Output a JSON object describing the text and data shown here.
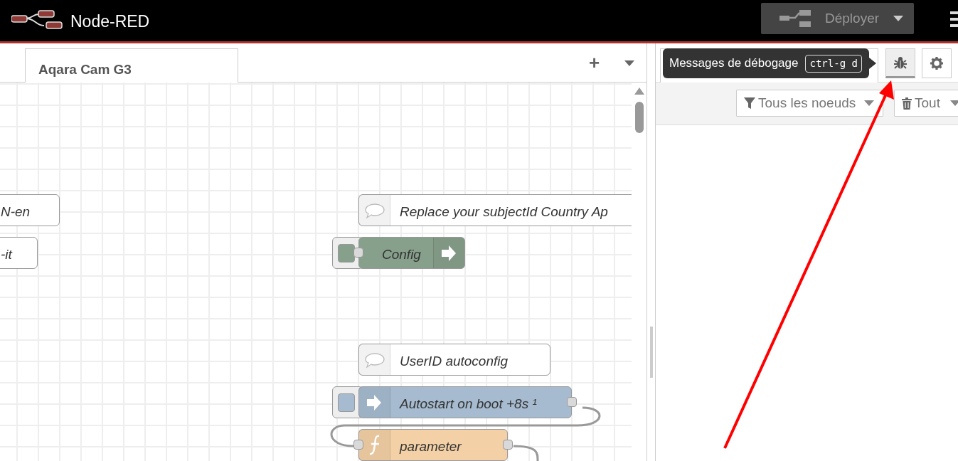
{
  "header": {
    "title": "Node-RED",
    "deploy": {
      "label": "Déployer",
      "disabled": true
    }
  },
  "workspace": {
    "tabs": [
      {
        "label": "Aqara Cam G3",
        "selected": true
      }
    ],
    "add_button": "+"
  },
  "nodes": [
    {
      "kind": "comment",
      "label": "N-en",
      "color": "#ffffff",
      "inputs": false,
      "outputs": false
    },
    {
      "kind": "comment",
      "label": "-it",
      "color": "#ffffff",
      "inputs": false,
      "outputs": false
    },
    {
      "kind": "comment",
      "label": "Replace your subjectId Country Ap",
      "color": "#ffffff",
      "inputs": false,
      "outputs": false
    },
    {
      "kind": "link-out",
      "label": "Config",
      "color": "#87a08c",
      "inputs": true,
      "outputs": false
    },
    {
      "kind": "comment",
      "label": "UserID autoconfig",
      "color": "#ffffff",
      "inputs": false,
      "outputs": false
    },
    {
      "kind": "inject",
      "label": "Autostart on boot +8s ¹",
      "color": "#a6bbcf",
      "inputs": false,
      "outputs": true
    },
    {
      "kind": "function",
      "label": "parameter",
      "color": "#f3d0a6",
      "inputs": true,
      "outputs": true
    }
  ],
  "sidebar": {
    "tabs": [
      {
        "kind": "debug",
        "selected": true
      },
      {
        "kind": "config",
        "selected": false
      }
    ],
    "tooltip": {
      "text": "Messages de débogage",
      "shortcut": "ctrl-g d"
    },
    "filter_button": "Tous les noeuds",
    "clear_button": "Tout"
  }
}
